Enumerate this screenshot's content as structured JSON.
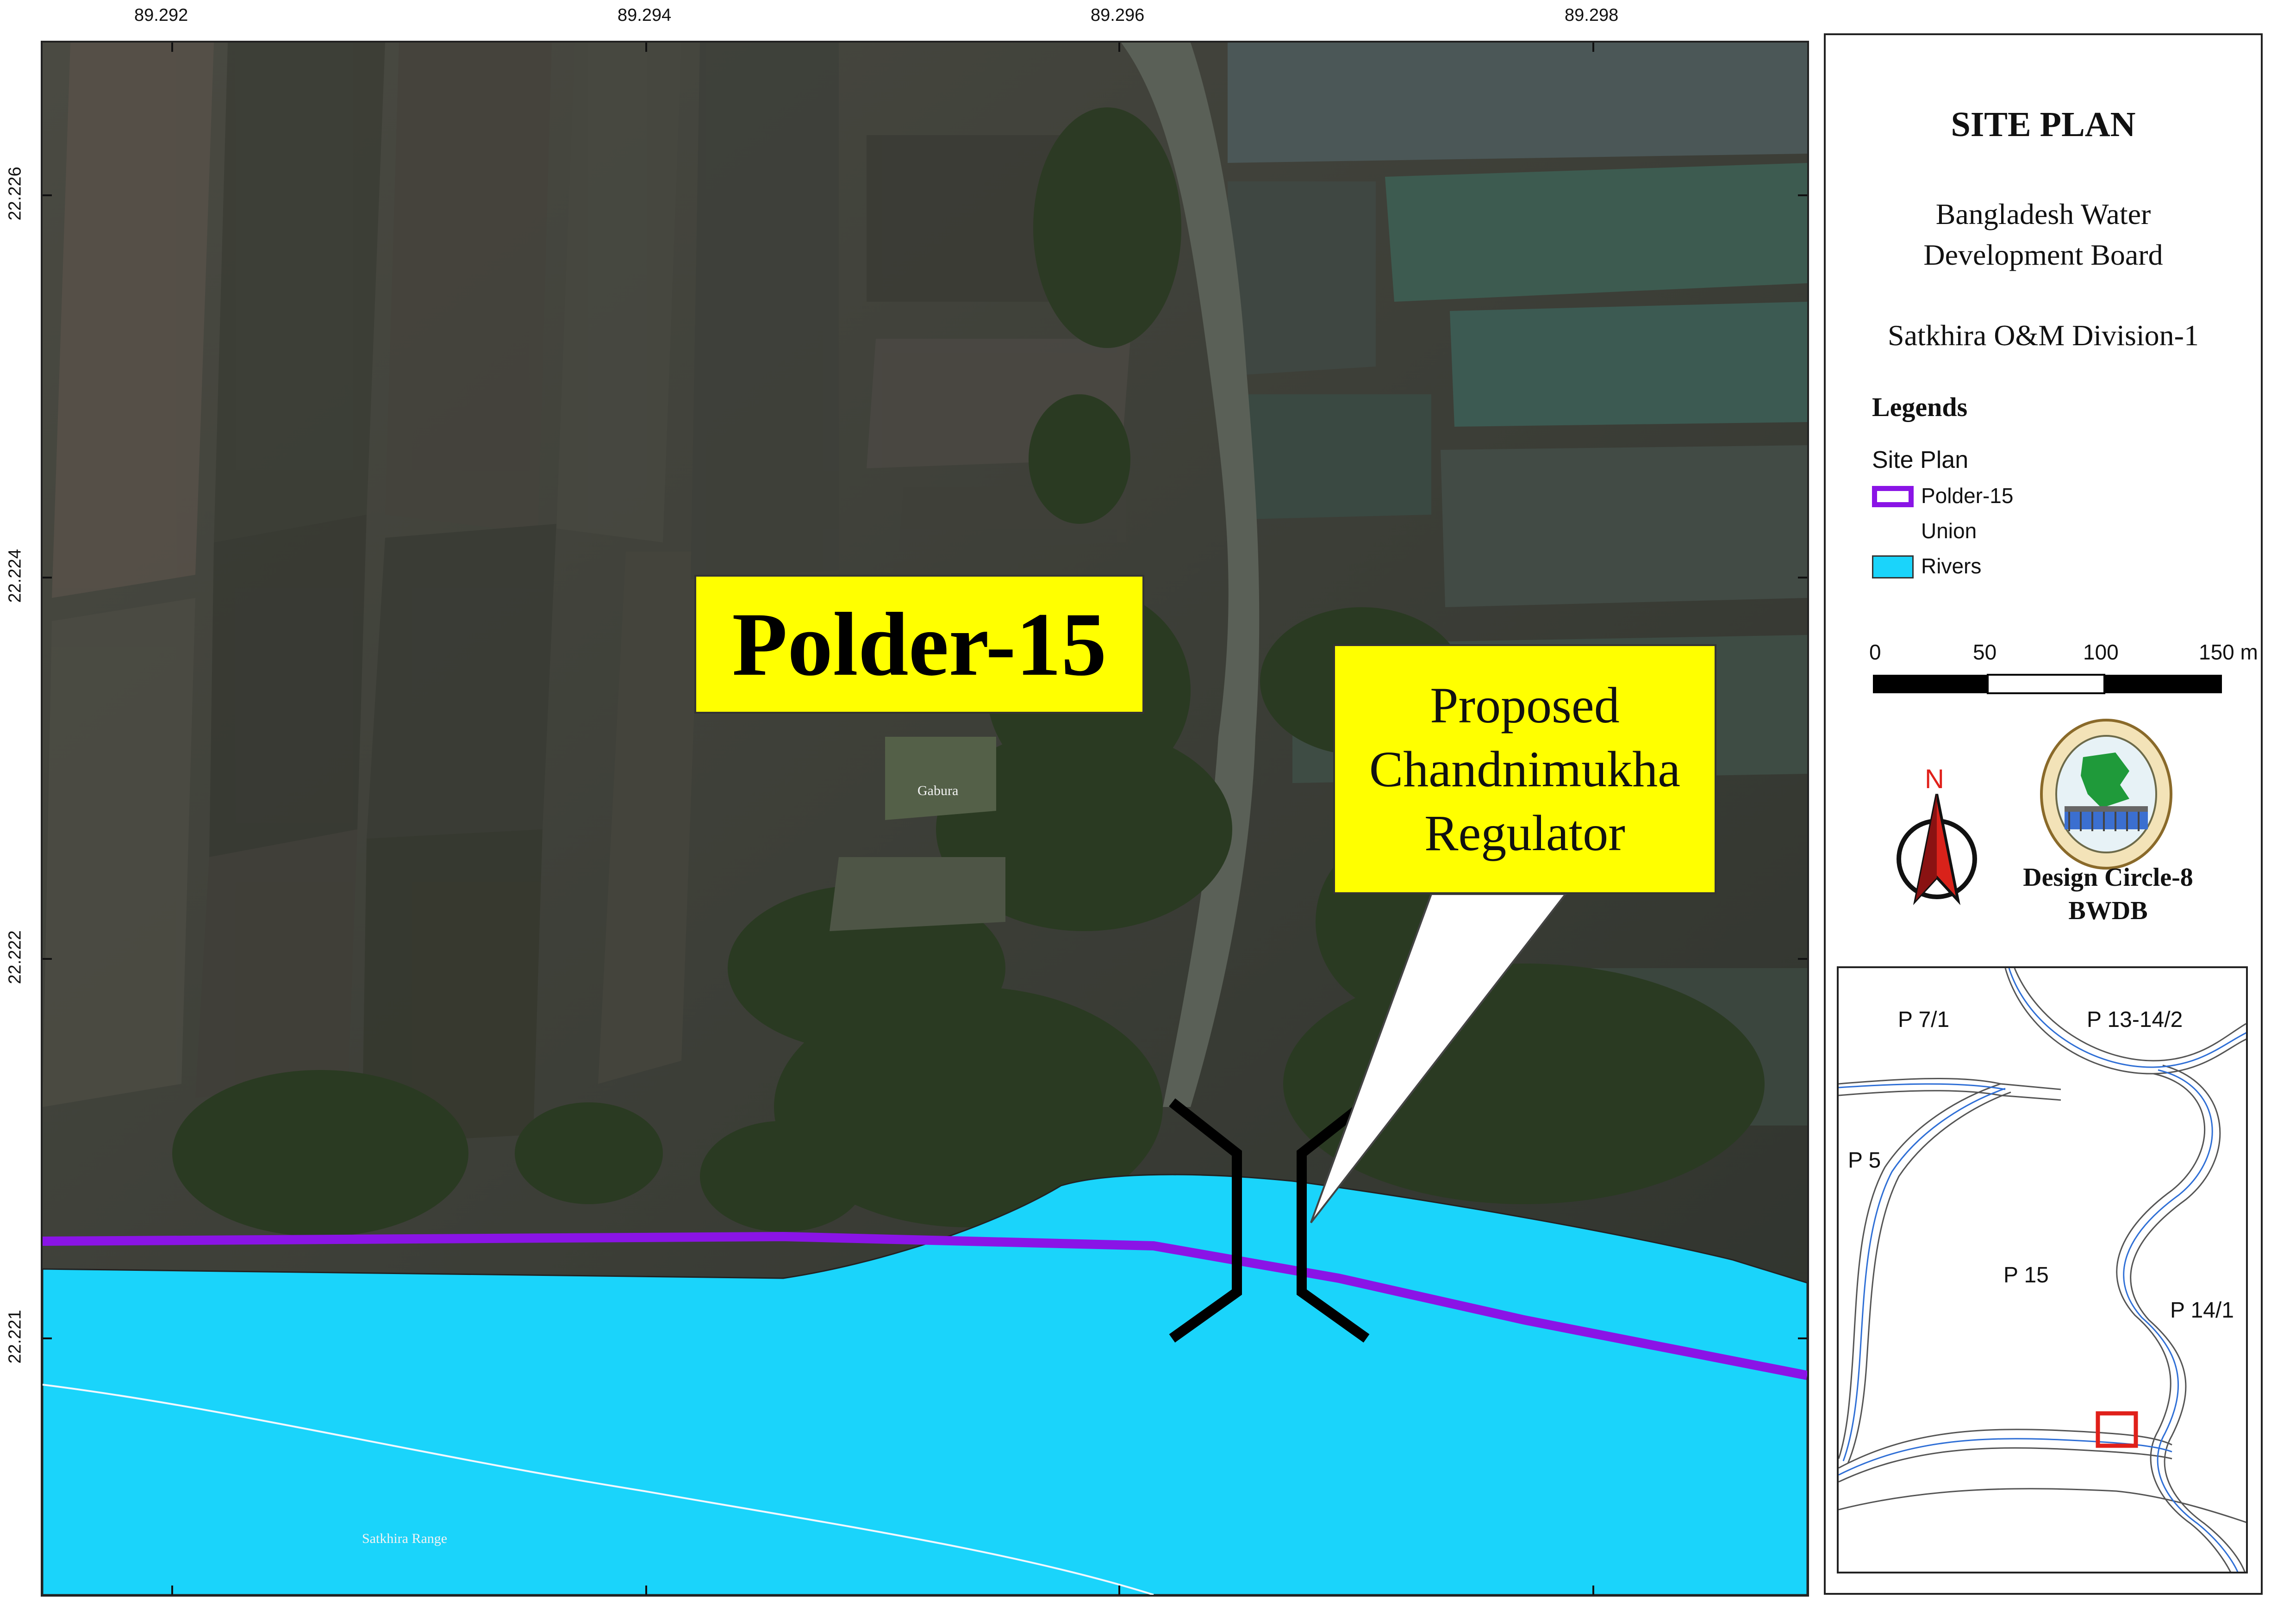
{
  "map": {
    "coords": {
      "top_longitudes": [
        "89.292",
        "89.294",
        "89.296",
        "89.298"
      ],
      "left_latitudes": [
        "22.226",
        "22.224",
        "22.222",
        "22.221"
      ]
    },
    "place_labels": {
      "village": "Gabura",
      "range": "Satkhira Range"
    },
    "polder_label": "Polder-15",
    "callout": {
      "line1": "Proposed",
      "line2": "Chandnimukha",
      "line3": "Regulator"
    },
    "colors": {
      "river": "#1ad4fb",
      "polder_line": "#8a14e6",
      "label_fill": "#ffff00",
      "regulator_symbol": "#000000"
    }
  },
  "panel": {
    "title": "SITE PLAN",
    "org_line1": "Bangladesh Water",
    "org_line2": "Development Board",
    "division": "Satkhira O&M Division-1",
    "legends_heading": "Legends",
    "legend_group": "Site Plan",
    "legend_items": [
      {
        "label": "Polder-15",
        "icon": "purple-outline-rectangle"
      },
      {
        "label": "Union",
        "icon": "none"
      },
      {
        "label": "Rivers",
        "icon": "cyan-filled-rectangle"
      }
    ],
    "scale_bar": {
      "ticks": [
        "0",
        "50",
        "100",
        "150 m"
      ]
    },
    "north_arrow_letter": "N",
    "credit_line1": "Design Circle-8",
    "credit_line2": "BWDB"
  },
  "inset": {
    "labels": [
      "P 7/1",
      "P 13-14/2",
      "P 5",
      "P 15",
      "P 14/1"
    ],
    "highlight_color": "#e0201a"
  }
}
